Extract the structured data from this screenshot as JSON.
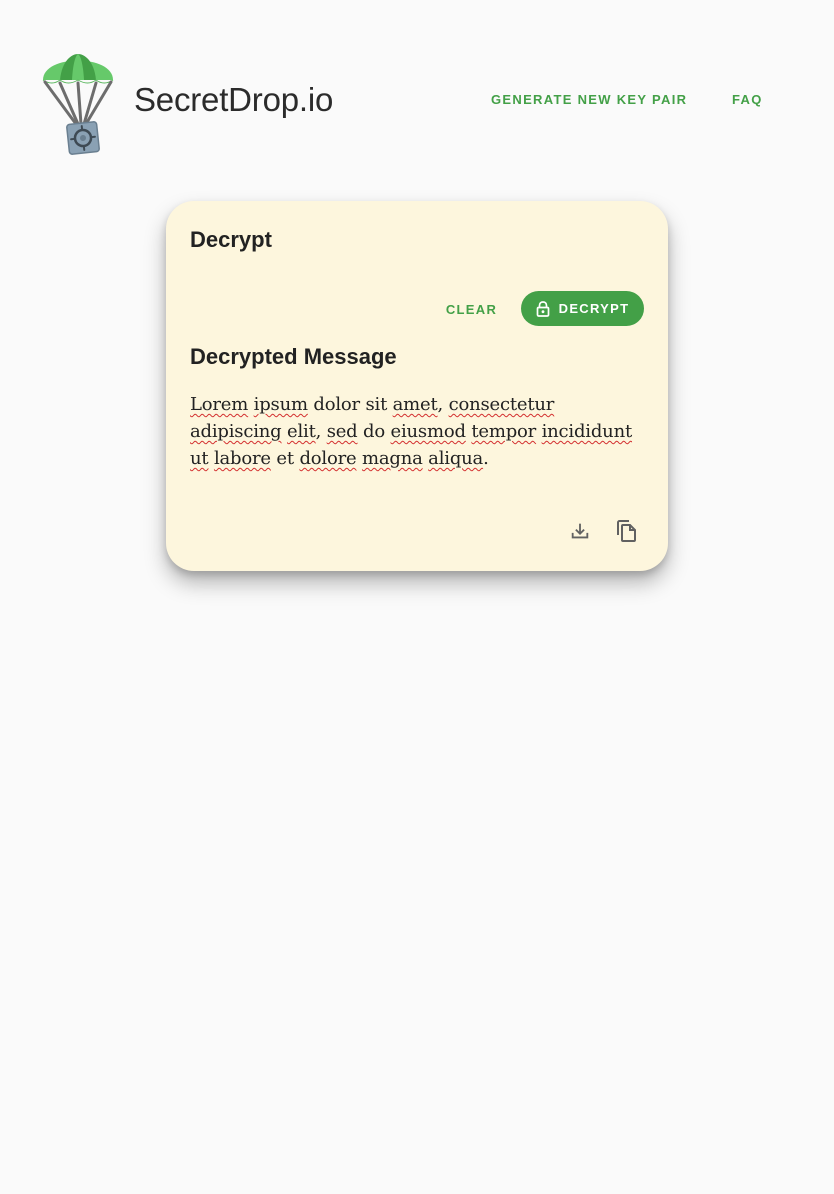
{
  "header": {
    "brand": "SecretDrop.io",
    "nav": {
      "generate_label": "GENERATE NEW KEY PAIR",
      "faq_label": "FAQ"
    }
  },
  "card": {
    "title": "Decrypt",
    "actions": {
      "clear_label": "CLEAR",
      "decrypt_label": "DECRYPT",
      "decrypt_icon": "lock-icon"
    },
    "result": {
      "title": "Decrypted Message",
      "words": [
        {
          "text": "Lorem",
          "misspelled": true
        },
        {
          "text": "ipsum",
          "misspelled": true
        },
        {
          "text": "dolor",
          "misspelled": false
        },
        {
          "text": "sit",
          "misspelled": false
        },
        {
          "text": "amet",
          "misspelled": true,
          "suffix": ","
        },
        {
          "text": "consectetur",
          "misspelled": true
        },
        {
          "text": "adipiscing",
          "misspelled": true
        },
        {
          "text": "elit",
          "misspelled": true,
          "suffix": ","
        },
        {
          "text": "sed",
          "misspelled": true
        },
        {
          "text": "do",
          "misspelled": false
        },
        {
          "text": "eiusmod",
          "misspelled": true
        },
        {
          "text": "tempor",
          "misspelled": true
        },
        {
          "text": "incididunt",
          "misspelled": true
        },
        {
          "text": "ut",
          "misspelled": true
        },
        {
          "text": "labore",
          "misspelled": true
        },
        {
          "text": "et",
          "misspelled": false
        },
        {
          "text": "dolore",
          "misspelled": true
        },
        {
          "text": "magna",
          "misspelled": true
        },
        {
          "text": "aliqua",
          "misspelled": true,
          "suffix": "."
        }
      ],
      "download_icon": "download-icon",
      "copy_icon": "copy-icon"
    }
  },
  "colors": {
    "accent": "#43a047",
    "card_background": "#fdf6dd",
    "page_background": "#fafafa",
    "spellcheck_underline": "#d32f2f"
  }
}
